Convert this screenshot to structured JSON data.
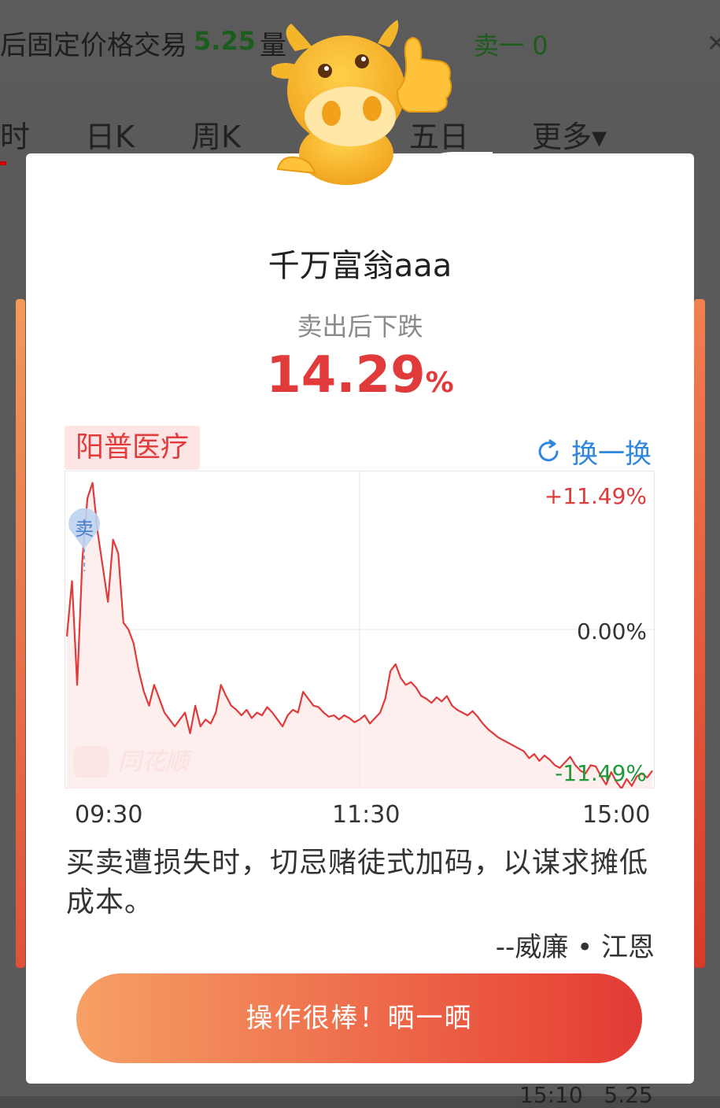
{
  "background_app": {
    "trade_label": "后固定价格交易",
    "trade_price": "5.25",
    "volume_label": "量",
    "sell1_label": "卖一",
    "sell1_value": "0",
    "tabs": [
      "时",
      "日K",
      "周K",
      "五日",
      "更多▾"
    ],
    "bottom_time": "15:10",
    "bottom_price": "5.25"
  },
  "popup": {
    "username": "千万富翁aaa",
    "subtitle": "卖出后下跌",
    "percent_value": "14.29",
    "percent_sign": "%",
    "stock_name": "阳普医疗",
    "refresh_label": "换一换",
    "watermark": "同花顺",
    "sell_marker": "卖",
    "quote": "买卖遭损失时，切忌赌徒式加码，以谋求摊低成本。",
    "author": "--威廉 • 江恩",
    "share_button": "操作很棒！晒一晒"
  },
  "chart_data": {
    "type": "line",
    "title": "",
    "x_tick_labels": [
      "09:30",
      "11:30",
      "15:00"
    ],
    "y_tick_labels": [
      "+11.49%",
      "0.00%",
      "-11.49%"
    ],
    "ylim": [
      -11.49,
      11.49
    ],
    "colors": {
      "line": "#e03a3a",
      "up": "#e03a3a",
      "down": "#1f9a3a",
      "fill": "#fde8e8"
    },
    "series": [
      {
        "values": [
          -0.5,
          3.5,
          -4.0,
          5.0,
          9.5,
          10.6,
          7.0,
          4.5,
          2.0,
          6.5,
          5.5,
          0.5,
          0.0,
          -1.0,
          -3.0,
          -4.5,
          -5.5,
          -4.0,
          -5.0,
          -6.0,
          -6.5,
          -7.0,
          -6.5,
          -6.0,
          -7.5,
          -5.5,
          -7.0,
          -6.5,
          -6.8,
          -6.0,
          -4.0,
          -4.8,
          -5.5,
          -5.8,
          -6.2,
          -5.8,
          -6.4,
          -6.0,
          -6.2,
          -5.6,
          -6.0,
          -6.5,
          -7.0,
          -6.2,
          -5.8,
          -6.0,
          -4.5,
          -5.0,
          -5.5,
          -5.6,
          -6.0,
          -6.3,
          -6.2,
          -6.5,
          -6.2,
          -6.4,
          -6.7,
          -6.5,
          -6.2,
          -6.8,
          -6.4,
          -6.0,
          -5.0,
          -3.0,
          -2.5,
          -3.5,
          -4.0,
          -3.8,
          -4.2,
          -4.8,
          -5.0,
          -5.3,
          -4.9,
          -5.2,
          -4.8,
          -5.5,
          -5.8,
          -6.0,
          -6.2,
          -5.9,
          -6.3,
          -6.8,
          -7.2,
          -7.5,
          -7.8,
          -8.0,
          -8.2,
          -8.4,
          -8.6,
          -8.8,
          -9.3,
          -9.0,
          -9.5,
          -9.1,
          -9.4,
          -9.8,
          -10.0,
          -9.6,
          -9.2,
          -9.8,
          -10.2,
          -10.4,
          -9.8,
          -9.9,
          -10.6,
          -11.2,
          -10.3,
          -11.0,
          -11.5,
          -10.8,
          -11.3,
          -10.6,
          -10.4,
          -10.7,
          -10.2
        ]
      }
    ],
    "sell_point_index": 4,
    "grid": true
  }
}
